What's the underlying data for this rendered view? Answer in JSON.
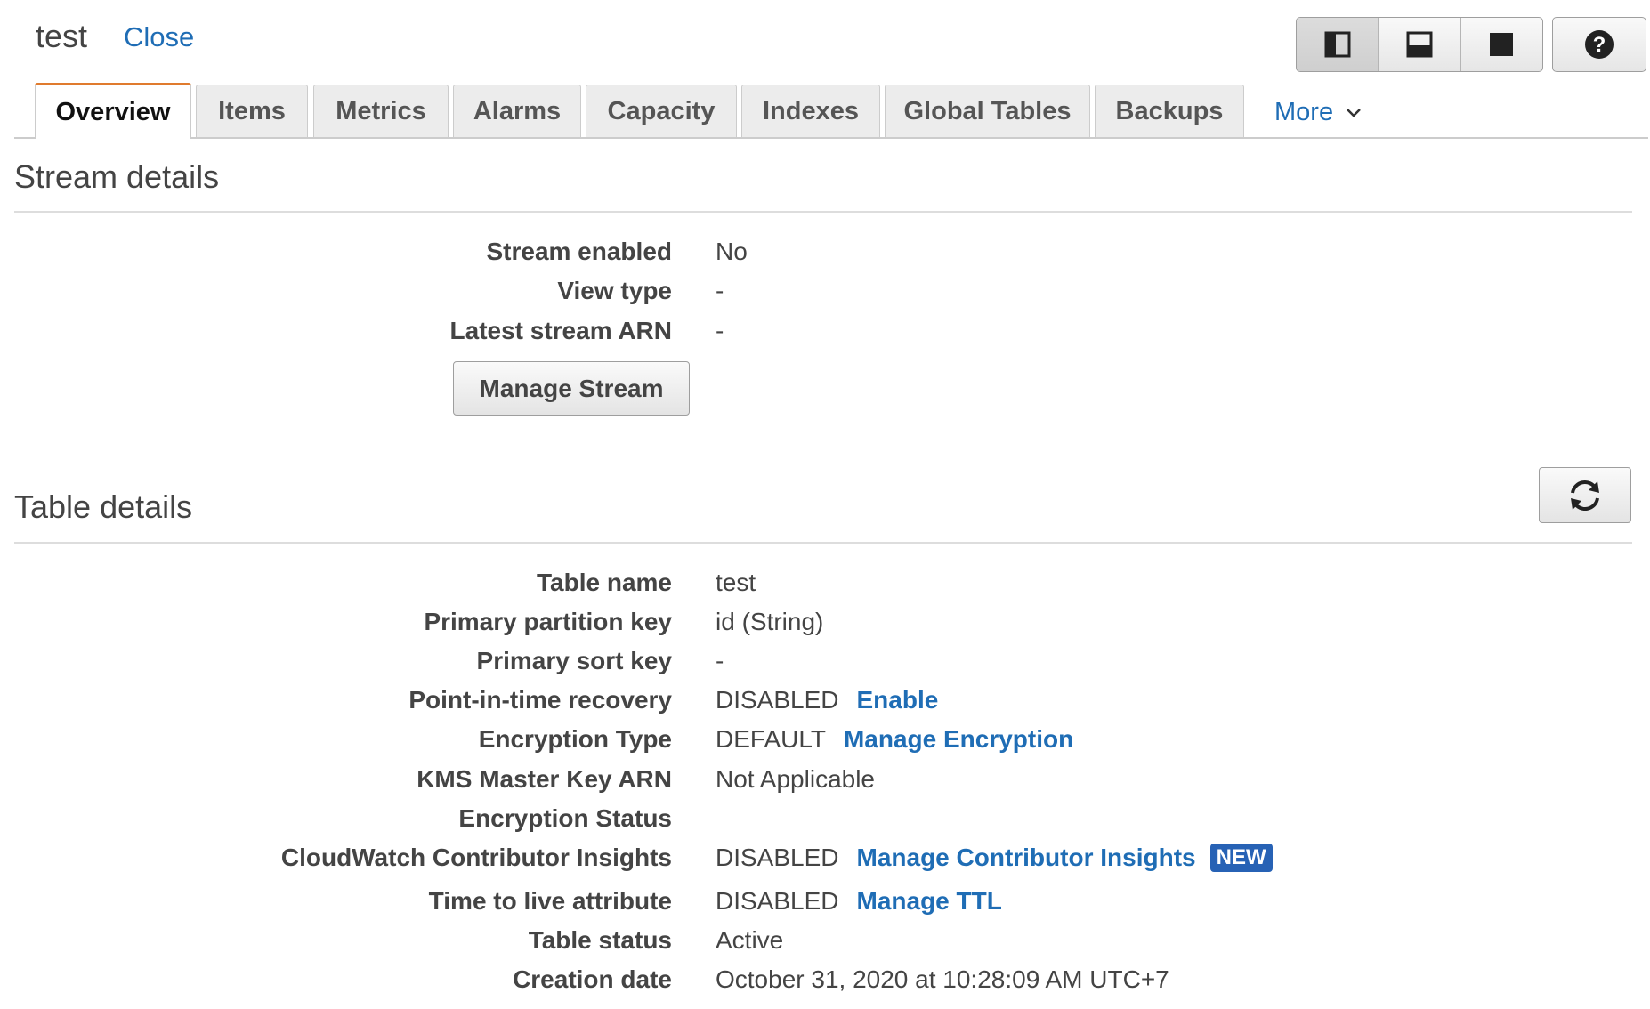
{
  "header": {
    "title": "test",
    "close_label": "Close"
  },
  "toolbar": {
    "view_icons": [
      "split-vertical-icon",
      "split-horizontal-icon",
      "full-view-icon"
    ],
    "help_icon": "help-icon"
  },
  "tabs": [
    {
      "label": "Overview",
      "active": true
    },
    {
      "label": "Items"
    },
    {
      "label": "Metrics"
    },
    {
      "label": "Alarms"
    },
    {
      "label": "Capacity"
    },
    {
      "label": "Indexes"
    },
    {
      "label": "Global Tables"
    },
    {
      "label": "Backups"
    }
  ],
  "more_tab": {
    "label": "More"
  },
  "stream": {
    "title": "Stream details",
    "rows": [
      {
        "label": "Stream enabled",
        "value": "No"
      },
      {
        "label": "View type",
        "value": "-"
      },
      {
        "label": "Latest stream ARN",
        "value": "-"
      }
    ],
    "manage_button": "Manage Stream"
  },
  "table": {
    "title": "Table details",
    "refresh_icon": "refresh-icon",
    "rows": [
      {
        "label": "Table name",
        "value": "test"
      },
      {
        "label": "Primary partition key",
        "value": "id (String)"
      },
      {
        "label": "Primary sort key",
        "value": "-"
      },
      {
        "label": "Point-in-time recovery",
        "value": "DISABLED",
        "link": "Enable"
      },
      {
        "label": "Encryption Type",
        "value": "DEFAULT",
        "link": "Manage Encryption"
      },
      {
        "label": "KMS Master Key ARN",
        "value": "Not Applicable"
      },
      {
        "label": "Encryption Status",
        "value": ""
      },
      {
        "label": "CloudWatch Contributor Insights",
        "value": "DISABLED",
        "link": "Manage Contributor Insights",
        "badge": "NEW"
      },
      {
        "label": "Time to live attribute",
        "value": "DISABLED",
        "link": "Manage TTL"
      },
      {
        "label": "Table status",
        "value": "Active"
      },
      {
        "label": "Creation date",
        "value": "October 31, 2020 at 10:28:09 AM UTC+7"
      }
    ]
  },
  "colors": {
    "link": "#1f6db5",
    "active_tab_accent": "#e07b2e",
    "badge": "#2762b5"
  }
}
